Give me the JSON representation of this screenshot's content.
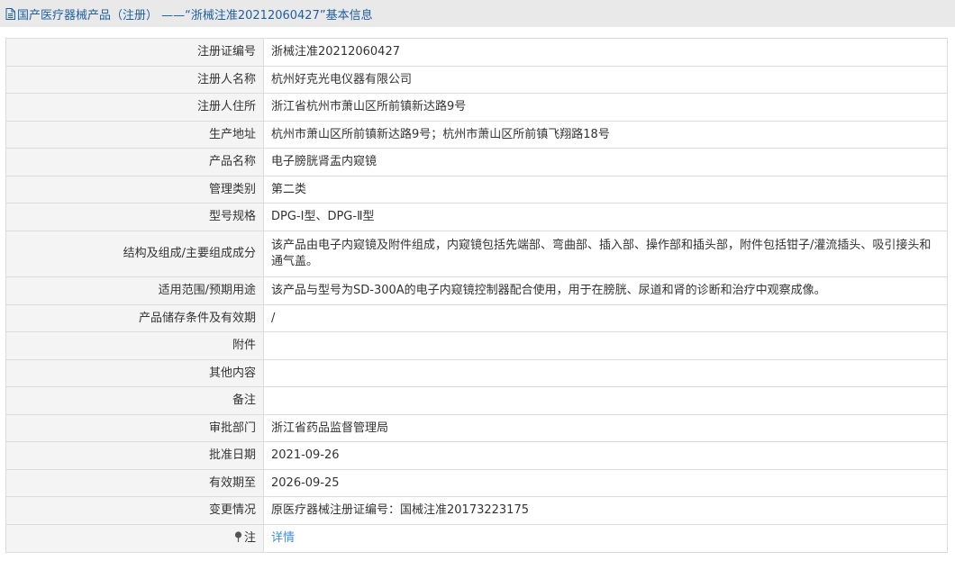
{
  "header": {
    "title": "国产医疗器械产品（注册） ——“浙械注准20212060427”基本信息",
    "icon": "document-icon"
  },
  "rows": [
    {
      "key": "reg-no",
      "label": "注册证编号",
      "value": "浙械注准20212060427"
    },
    {
      "key": "registrant",
      "label": "注册人名称",
      "value": "杭州好克光电仪器有限公司"
    },
    {
      "key": "registrant-address",
      "label": "注册人住所",
      "value": "浙江省杭州市萧山区所前镇新达路9号"
    },
    {
      "key": "production-address",
      "label": "生产地址",
      "value": "杭州市萧山区所前镇新达路9号；杭州市萧山区所前镇飞翔路18号"
    },
    {
      "key": "product-name",
      "label": "产品名称",
      "value": "电子膀胱肾盂内窥镜"
    },
    {
      "key": "category",
      "label": "管理类别",
      "value": "第二类"
    },
    {
      "key": "model",
      "label": "型号规格",
      "value": "DPG-Ⅰ型、DPG-Ⅱ型"
    },
    {
      "key": "structure",
      "label": "结构及组成/主要组成成分",
      "value": "该产品由电子内窥镜及附件组成，内窥镜包括先端部、弯曲部、插入部、操作部和插头部，附件包括钳子/灌流插头、吸引接头和通气盖。"
    },
    {
      "key": "intended-use",
      "label": "适用范围/预期用途",
      "value": "该产品与型号为SD-300A的电子内窥镜控制器配合使用，用于在膀胱、尿道和肾的诊断和治疗中观察成像。"
    },
    {
      "key": "storage",
      "label": "产品储存条件及有效期",
      "value": "/"
    },
    {
      "key": "attachment",
      "label": "附件",
      "value": ""
    },
    {
      "key": "other",
      "label": "其他内容",
      "value": ""
    },
    {
      "key": "remarks",
      "label": "备注",
      "value": ""
    },
    {
      "key": "approval-dept",
      "label": "审批部门",
      "value": "浙江省药品监督管理局"
    },
    {
      "key": "approval-date",
      "label": "批准日期",
      "value": "2021-09-26"
    },
    {
      "key": "expiry-date",
      "label": "有效期至",
      "value": "2026-09-25"
    },
    {
      "key": "change",
      "label": "变更情况",
      "value": "原医疗器械注册证编号：国械注准20173223175"
    }
  ],
  "note_row": {
    "label": "注",
    "icon": "pin-icon",
    "link_text": "详情"
  },
  "colors": {
    "header_bg": "#e9e9e9",
    "header_text": "#1f5fa0",
    "label_bg": "#f4f4f4",
    "border": "#dcdcdc",
    "link": "#3a8ee6"
  }
}
